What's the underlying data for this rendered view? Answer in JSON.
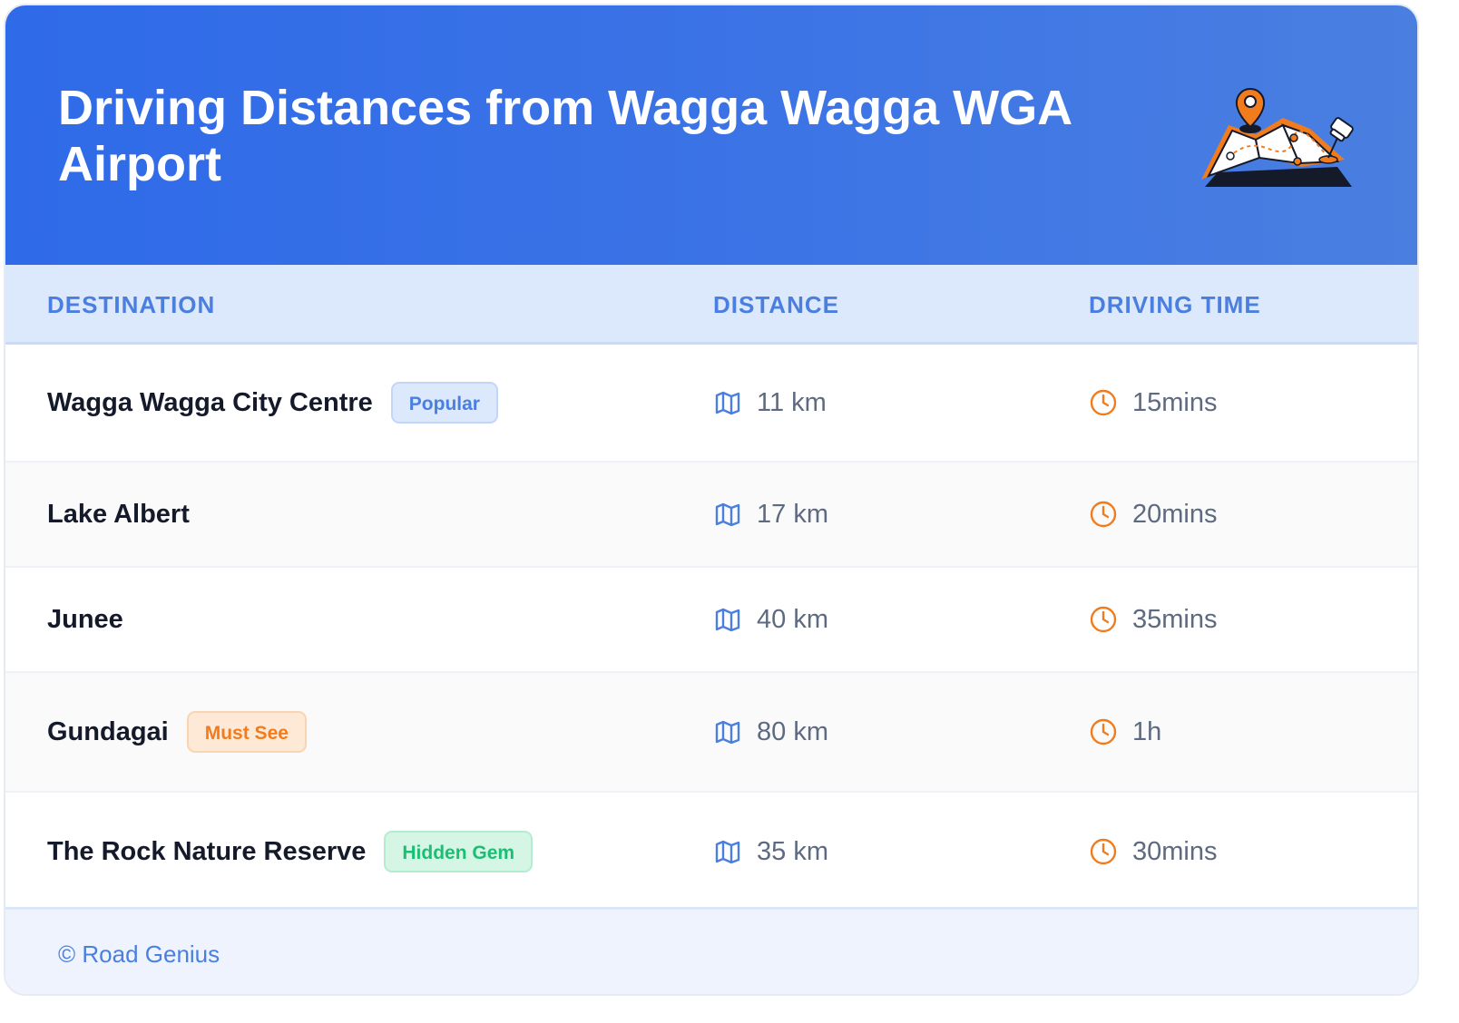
{
  "header": {
    "title": "Driving Distances from Wagga Wagga WGA Airport",
    "illustration": "map-with-pins-icon"
  },
  "table": {
    "columns": [
      "DESTINATION",
      "DISTANCE",
      "DRIVING TIME"
    ],
    "rows": [
      {
        "destination": "Wagga Wagga City Centre",
        "badge": "Popular",
        "distance": "11 km",
        "time": "15mins"
      },
      {
        "destination": "Lake Albert",
        "badge": "",
        "distance": "17 km",
        "time": "20mins"
      },
      {
        "destination": "Junee",
        "badge": "",
        "distance": "40 km",
        "time": "35mins"
      },
      {
        "destination": "Gundagai",
        "badge": "Must See",
        "distance": "80 km",
        "time": "1h"
      },
      {
        "destination": "The Rock Nature Reserve",
        "badge": "Hidden Gem",
        "distance": "35 km",
        "time": "30mins"
      }
    ]
  },
  "icons": {
    "distance": "map-icon",
    "time": "clock-icon"
  },
  "footer": {
    "text": "© Road Genius"
  },
  "colors": {
    "header_gradient_start": "#2f6ae8",
    "header_gradient_end": "#4a7fe0",
    "accent_blue": "#4a7fe0",
    "accent_orange": "#f07c1e",
    "accent_green": "#1dbd74"
  }
}
